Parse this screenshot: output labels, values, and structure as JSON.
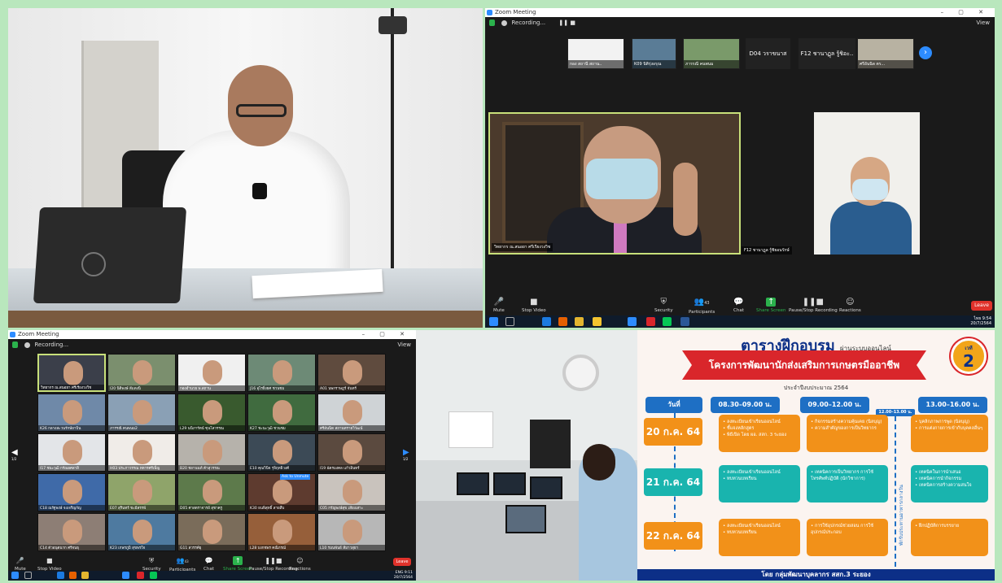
{
  "zoom_main": {
    "window_title": "Zoom Meeting",
    "window_controls": "– ▢ ✕",
    "recording": "Recording...",
    "view": "View",
    "thumbs": [
      {
        "name": "กอง สถานี สถาน.."
      },
      {
        "name": "K09 นิติรุ่งอรุณ"
      },
      {
        "name": "ภารรณี คนพนม"
      },
      {
        "name": "D04 วราขนาส"
      },
      {
        "name": "F12 ชานาฏุล รู้ชิอะ.."
      },
      {
        "name": "ศรีอันนิด ตร..."
      }
    ],
    "big_video_name": "วิทยากร ณ.สนอยา ศรีเรียงวงวิช",
    "small_video_name": "F12 ชานาฏุล รู้ชิยอนรักษ์",
    "toolbar": {
      "mute": "Mute",
      "stop_video": "Stop Video",
      "security": "Security",
      "participants": "Participants",
      "participant_count": "43",
      "chat": "Chat",
      "share": "Share Screen",
      "record": "Pause/Stop Recording",
      "reactions": "Reactions",
      "leave": "Leave"
    },
    "clock": {
      "time": "9:54",
      "date": "20/7/2564",
      "lang": "ไทย"
    }
  },
  "zoom_gallery": {
    "window_title": "Zoom Meeting",
    "recording": "Recording...",
    "view": "View",
    "page_left": "1/2",
    "page_right": "1/2",
    "tiles": [
      {
        "name": "วิทยากร ณ.สนอยา ศรีเรียงวงวิช"
      },
      {
        "name": "I20 นิติพงษ์ สีแดงนิ"
      },
      {
        "name": "กองอำนวย พ.สถาน"
      },
      {
        "name": "J16 อุไรยิ่งยศ ชวนชม"
      },
      {
        "name": "A01 นพกราษฎร์ จันทร์"
      },
      {
        "name": "K26 กลางสะวนรักษ์ยาบิน"
      },
      {
        "name": "ภารรณี คนพนม2"
      },
      {
        "name": "L29 นนิภารัตน์ ซุนโสวรรณ"
      },
      {
        "name": "K27 ชะนะวุฒิ ชวนชม"
      },
      {
        "name": "ศรีอันนิด สถานทรายวิวัฒน์"
      },
      {
        "name": "I17 ชนะวุฒิ กรัณยศสาสิ"
      },
      {
        "name": "H03 ประภาวรรณ ทหารศรีเพ็ญ"
      },
      {
        "name": "B20 ชยานนท์ ค้าสุวรรณ"
      },
      {
        "name": "E10 คุณวินิจ รุจิฤทธิวงศ์"
      },
      {
        "name": "I19 ฉัตรมงคล แก้วอินทร์"
      },
      {
        "name": "C18 ณรัฐพงษ์ จงเจริญกัญ"
      },
      {
        "name": "E07 สุรินทร์ ชะมีสรรพ์"
      },
      {
        "name": "D05 ศาสตราจารย์ สุชาครู"
      },
      {
        "name": "K30 ธนพิสุทธิ์ สายสืบ"
      },
      {
        "name": "C05 กรัญพงษ์สุข เสียงเสาะ"
      },
      {
        "name": "C14 ตัวอนุตนาก ศรีจนธุ"
      },
      {
        "name": "K23 เกษรภูมิ สุขพรใจ"
      },
      {
        "name": "G11 สวรรค์ยุ"
      },
      {
        "name": "L28 บงกชพร คณิภรณ์"
      },
      {
        "name": "L10 รมนพันธ์ สีมาวสุยา"
      }
    ],
    "rename_tooltip": "Ask to Unmute",
    "toolbar": {
      "mute": "Mute",
      "stop_video": "Stop Video",
      "security": "Security",
      "participants": "Participants",
      "participant_count": "43",
      "chat": "Chat",
      "share": "Share Screen",
      "record": "Pause/Stop Recording",
      "reactions": "Reactions",
      "leave": "Leave"
    },
    "clock": {
      "time": "9:11",
      "date": "20/7/2564",
      "lang": "ENG"
    }
  },
  "poster": {
    "title": "ตารางฝึกอบรม",
    "title_suffix": "ผ่านระบบออนไลน์",
    "project": "โครงการพัฒนานักส่งเสริมการเกษตรมืออาชีพ",
    "budget_year": "ประจำปีงบประมาณ 2564",
    "round_label": "เวที",
    "round_number": "2",
    "col_date": "วันที่",
    "col_t1": "08.30–09.00 น.",
    "col_t2": "09.00–12.00 น.",
    "col_lunch": "12.00–13.00 น.",
    "col_t3": "13.00–16.00 น.",
    "lunch_text": "พักรับประทานอาหารกลางวัน",
    "rows": [
      {
        "date": "20 ก.ค. 64",
        "a1": "• ลงทะเบียนเข้าเรียนออนไลน์\n• ชี้แจงหลักสูตร\n• พิธีเปิด โดย ผอ. สสก. 3 ระยอง",
        "a2": "• กิจกรรมสร้างความคุ้นเคย (นิลบุญ)\n• ความสำคัญของการเป็นวิทยากร",
        "a3": "• บุคลิกภาพการพูด (นิลบุญ)\n• การแต่งกายการเข้ากับบุคคลอื่นๆ"
      },
      {
        "date": "21 ก.ค. 64",
        "a1": "• ลงทะเบียนเข้าเรียนออนไลน์\n• ทบทวนบทเรียน",
        "a2": "• เทคนิคการเป็นวิทยากร การใช้โทรศัพท์ปฏิบัติ (นักวิชาการ)",
        "a3": "• เทคนิคในการนำเสนอ\n• เทคนิคการนำกิจกรรม\n• เทคนิคการสร้างความสนใจ"
      },
      {
        "date": "22 ก.ค. 64",
        "a1": "• ลงทะเบียนเข้าเรียนออนไลน์\n• ทบทวนบทเรียน",
        "a2": "• การใช้อุปกรณ์ช่วยสอน การใช้อุปกรณ์ประกอบ",
        "a3": "• ฝึกปฏิบัติการบรรยาย"
      }
    ],
    "footer": "โดย กลุ่มพัฒนาบุคลากร สสก.3 ระยอง",
    "colors": {
      "navy": "#0c2f87",
      "red": "#d9262b",
      "orange": "#f29119",
      "teal": "#19b4ae",
      "blue": "#1e6fc4"
    }
  }
}
